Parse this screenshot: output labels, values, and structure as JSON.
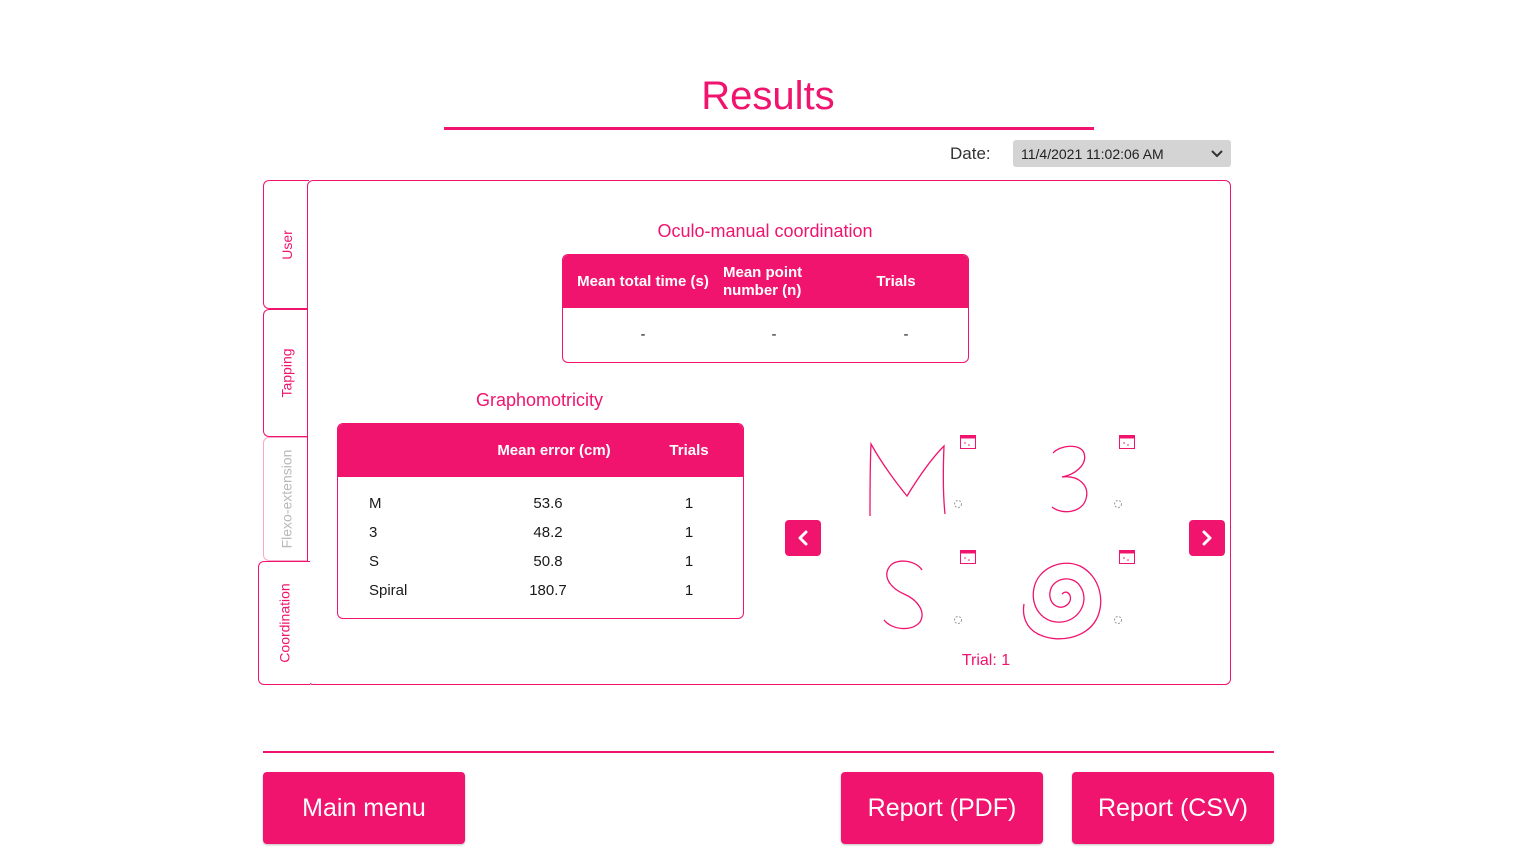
{
  "page": {
    "title": "Results"
  },
  "date": {
    "label": "Date:",
    "selected": "11/4/2021 11:02:06 AM"
  },
  "tabs": [
    {
      "label": "User",
      "active": false,
      "enabled": true
    },
    {
      "label": "Tapping",
      "active": false,
      "enabled": true
    },
    {
      "label": "Flexo-extension",
      "active": false,
      "enabled": false
    },
    {
      "label": "Coordination",
      "active": true,
      "enabled": true
    }
  ],
  "oculo": {
    "title": "Oculo-manual coordination",
    "headers": [
      "Mean total time (s)",
      "Mean point number (n)",
      "Trials"
    ],
    "values": [
      "-",
      "-",
      "-"
    ]
  },
  "grapho": {
    "title": "Graphomotricity",
    "headers": [
      "",
      "Mean error (cm)",
      "Trials"
    ],
    "rows": [
      {
        "name": "M",
        "error": "53.6",
        "trials": "1"
      },
      {
        "name": "3",
        "error": "48.2",
        "trials": "1"
      },
      {
        "name": "S",
        "error": "50.8",
        "trials": "1"
      },
      {
        "name": "Spiral",
        "error": "180.7",
        "trials": "1"
      }
    ]
  },
  "gallery": {
    "trial_label": "Trial: 1",
    "drawings": [
      "M",
      "3",
      "S",
      "Spiral"
    ]
  },
  "buttons": {
    "main_menu": "Main menu",
    "report_pdf": "Report (PDF)",
    "report_csv": "Report (CSV)"
  },
  "colors": {
    "accent": "#f0146e",
    "dim_tab_text": "#b8b8b8",
    "select_bg": "#d4d4d4"
  },
  "icons": [
    "chevron-down-icon",
    "chevron-left-icon",
    "chevron-right-icon",
    "image-thumbnail-icon",
    "loading-spinner-icon"
  ]
}
